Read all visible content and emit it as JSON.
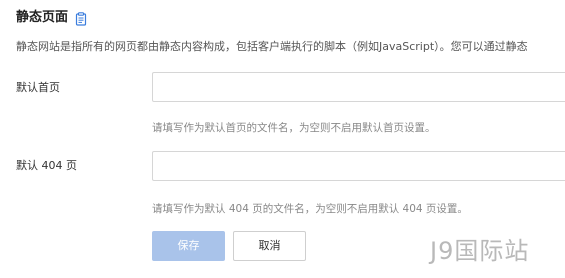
{
  "section": {
    "title": "静态页面",
    "icon": "doc-icon",
    "description": "静态网站是指所有的网页都由静态内容构成，包括客户端执行的脚本（例如JavaScript）。您可以通过静态"
  },
  "form": {
    "index_page": {
      "label": "默认首页",
      "value": "",
      "placeholder": "",
      "hint": "请填写作为默认首页的文件名，为空则不启用默认首页设置。"
    },
    "error_page": {
      "label": "默认 404 页",
      "value": "",
      "placeholder": "",
      "hint": "请填写作为默认 404 页的文件名，为空则不启用默认 404 页设置。"
    }
  },
  "actions": {
    "save_label": "保存",
    "cancel_label": "取消"
  },
  "watermark": "J9国际站",
  "colors": {
    "primary_disabled": "#a9c3ea",
    "icon_blue": "#3b7ddd",
    "border": "#d6d6d6",
    "hint_text": "#888888"
  }
}
